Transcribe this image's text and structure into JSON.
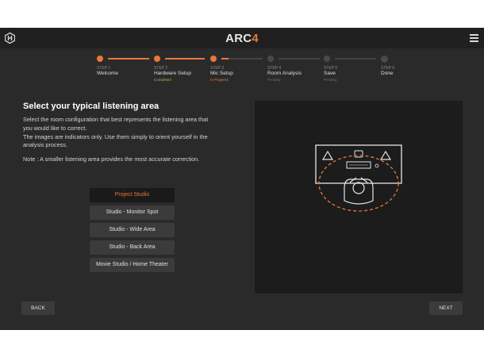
{
  "app": {
    "title_text": "ARC",
    "title_number": "4"
  },
  "steps": [
    {
      "num": "STEP 1",
      "name": "Welcome",
      "status": "",
      "state": "done"
    },
    {
      "num": "STEP 2",
      "name": "Hardware Setup",
      "status": "Completed",
      "state": "done"
    },
    {
      "num": "STEP 3",
      "name": "Mic Setup",
      "status": "In Progress",
      "state": "active"
    },
    {
      "num": "STEP 4",
      "name": "Room Analysis",
      "status": "Pending",
      "state": "pending"
    },
    {
      "num": "STEP 5",
      "name": "Save",
      "status": "Pending",
      "state": "pending"
    },
    {
      "num": "STEP 6",
      "name": "Done",
      "status": "",
      "state": "pending"
    }
  ],
  "content": {
    "heading": "Select your typical listening area",
    "desc_1": "Select the room configuration that best represents the listening area that you would like to correct.",
    "desc_2": "The images are indicators only. Use them simply to orient yourself in the analysis process.",
    "note": "Note : A smaller listening area provides the most accurate correction."
  },
  "options": [
    {
      "label": "Project Studio",
      "selected": true
    },
    {
      "label": "Studio - Monitor Spot",
      "selected": false
    },
    {
      "label": "Studio - Wide Area",
      "selected": false
    },
    {
      "label": "Studio - Back Area",
      "selected": false
    },
    {
      "label": "Movie Studio / Home Theater",
      "selected": false
    }
  ],
  "nav": {
    "back": "BACK",
    "next": "NEXT"
  },
  "colors": {
    "accent": "#e8793c",
    "completed": "#8bc34a",
    "in_progress": "#e8793c",
    "pending": "#6b6b6b"
  },
  "icons": {
    "logo": "ik-logo-icon",
    "menu": "hamburger-menu-icon"
  }
}
